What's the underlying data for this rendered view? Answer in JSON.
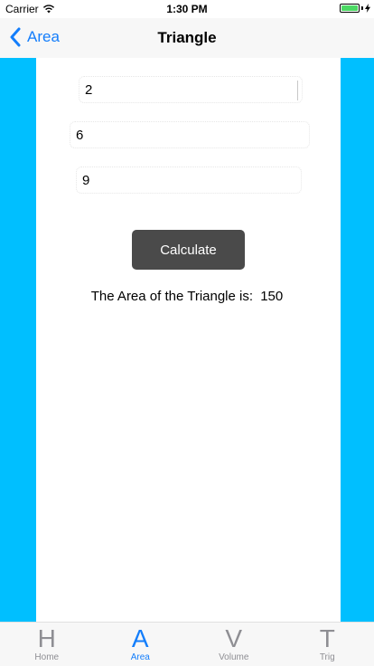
{
  "status_bar": {
    "carrier": "Carrier",
    "time": "1:30 PM",
    "wifi_icon": "wifi-icon",
    "battery_icon": "battery-icon",
    "charging_icon": "bolt-icon",
    "battery_color": "#4cd964"
  },
  "nav": {
    "back_label": "Area",
    "back_icon": "chevron-left-icon",
    "title": "Triangle",
    "accent_color": "#147efb"
  },
  "form": {
    "field1_value": "2",
    "field2_value": "6",
    "field3_value": "9",
    "calculate_label": "Calculate",
    "result_prefix": "The Area of the Triangle is:",
    "result_value": "150",
    "side_color": "#00bfff",
    "button_color": "#4a4a4a"
  },
  "tabs": [
    {
      "icon": "H",
      "label": "Home",
      "active": false
    },
    {
      "icon": "A",
      "label": "Area",
      "active": true
    },
    {
      "icon": "V",
      "label": "Volume",
      "active": false
    },
    {
      "icon": "T",
      "label": "Trig",
      "active": false
    }
  ]
}
